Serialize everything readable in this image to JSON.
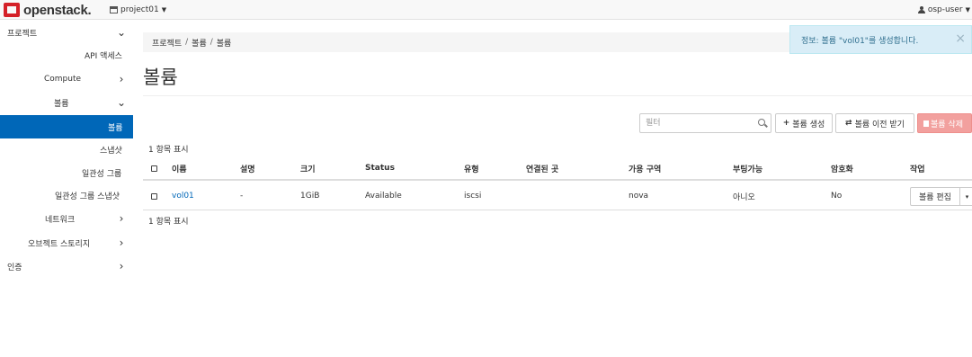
{
  "navbar": {
    "logo_text": "openstack.",
    "project": "project01",
    "user": "osp-user"
  },
  "sidebar": {
    "items": [
      {
        "label": "프로젝트",
        "chevron": "⌄"
      },
      {
        "label": "API 액세스"
      },
      {
        "label": "Compute",
        "chevron": "›"
      },
      {
        "label": "볼륨",
        "chevron": "⌄"
      },
      {
        "label": "볼륨"
      },
      {
        "label": "스냅샷"
      },
      {
        "label": "일관성 그룹"
      },
      {
        "label": "일관성 그룹 스냅샷"
      },
      {
        "label": "네트워크",
        "chevron": "›"
      },
      {
        "label": "오브젝트 스토리지",
        "chevron": "›"
      },
      {
        "label": "인증",
        "chevron": "›"
      }
    ]
  },
  "breadcrumb": [
    "프로젝트",
    "볼륨",
    "볼륨"
  ],
  "page_title": "볼륨",
  "alert": {
    "text": "정보: 볼륨 \"vol01\"를 생성합니다.",
    "close": "×"
  },
  "toolbar": {
    "filter_placeholder": "필터",
    "create_label": "볼륨 생성",
    "create_icon": "+",
    "transfer_label": "볼륨 이전 받기",
    "transfer_icon": "⇄",
    "delete_label": "볼륨 삭제"
  },
  "count_text": "1 항목 표시",
  "table": {
    "headers": [
      "이름",
      "설명",
      "크기",
      "Status",
      "유형",
      "연결된 곳",
      "가용 구역",
      "부팅가능",
      "암호화",
      "작업"
    ],
    "rows": [
      {
        "name": "vol01",
        "description": "-",
        "size": "1GiB",
        "status": "Available",
        "type": "iscsi",
        "attached_to": "",
        "zone": "nova",
        "bootable": "아니오",
        "encrypted": "No",
        "action": "볼륨 편집",
        "action_caret": "▾"
      }
    ]
  }
}
